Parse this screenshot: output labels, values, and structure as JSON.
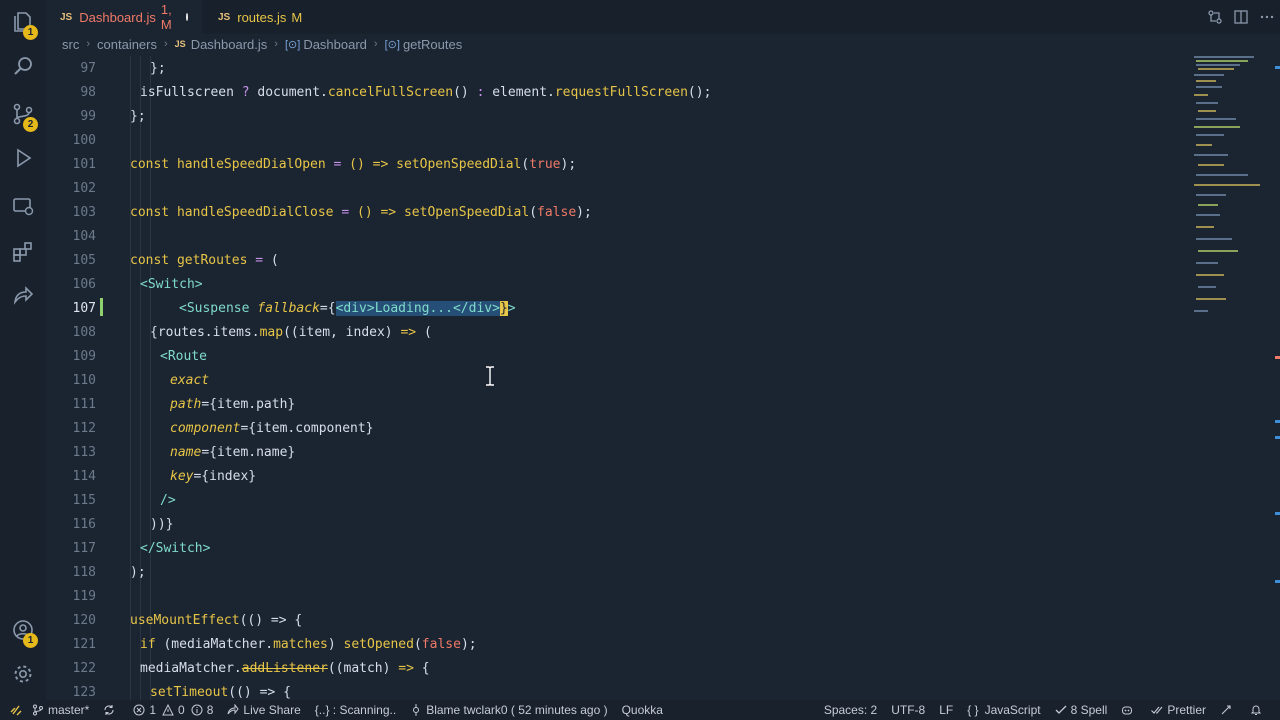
{
  "activity": {
    "explorer_badge": "1",
    "scm_badge": "2",
    "account_badge": "1"
  },
  "tabs": [
    {
      "icon": "JS",
      "name": "Dashboard.js",
      "meta": "1, M"
    },
    {
      "icon": "JS",
      "name": "routes.js",
      "meta": "M"
    }
  ],
  "breadcrumb": {
    "items": [
      "src",
      "containers",
      "Dashboard.js",
      "Dashboard",
      "getRoutes"
    ],
    "file_icon": "JS",
    "symbol_icon": "[⊙]"
  },
  "editor": {
    "line_numbers": [
      "97",
      "98",
      "99",
      "100",
      "101",
      "102",
      "103",
      "104",
      "105",
      "106",
      "107",
      "108",
      "109",
      "110",
      "111",
      "112",
      "113",
      "114",
      "115",
      "116",
      "117",
      "118",
      "119",
      "120",
      "121",
      "122",
      "123"
    ],
    "current_line": "107"
  },
  "code": {
    "l97": "};",
    "l98_a": "isFullscreen",
    "l98_b": "?",
    "l98_c": "document.",
    "l98_d": "cancelFullScreen",
    "l98_e": "()",
    "l98_f": ":",
    "l98_g": "element.",
    "l98_h": "requestFullScreen",
    "l98_i": "();",
    "l99": "};",
    "l101_a": "const",
    "l101_b": "handleSpeedDialOpen",
    "l101_c": "=",
    "l101_d": "() =>",
    "l101_e": "setOpenSpeedDial",
    "l101_f": "(",
    "l101_g": "true",
    "l101_h": ");",
    "l103_a": "const",
    "l103_b": "handleSpeedDialClose",
    "l103_c": "=",
    "l103_d": "() =>",
    "l103_e": "setOpenSpeedDial",
    "l103_f": "(",
    "l103_g": "false",
    "l103_h": ");",
    "l105_a": "const",
    "l105_b": "getRoutes",
    "l105_c": "=",
    "l105_d": "(",
    "l106": "<Switch>",
    "l107_a": "<Suspense",
    "l107_b": "fallback",
    "l107_c": "={",
    "l107_d": "<div>Loading...</div>",
    "l107_e": "}",
    "l107_f": ">",
    "l108_a": "{routes.items.",
    "l108_b": "map",
    "l108_c": "((item, index)",
    "l108_d": "=>",
    "l108_e": "(",
    "l109": "<Route",
    "l110": "exact",
    "l111_a": "path",
    "l111_b": "={item.path}",
    "l112_a": "component",
    "l112_b": "={item.component}",
    "l113_a": "name",
    "l113_b": "={item.name}",
    "l114_a": "key",
    "l114_b": "={index}",
    "l115": "/>",
    "l116": "))}",
    "l117": "</Switch>",
    "l118": ");",
    "l120_a": "useMountEffect",
    "l120_b": "(() =>",
    "l120_c": "{",
    "l121_a": "if",
    "l121_b": "(mediaMatcher.",
    "l121_c": "matches",
    "l121_d": ")",
    "l121_e": "setOpened",
    "l121_f": "(",
    "l121_g": "false",
    "l121_h": ");",
    "l122_a": "mediaMatcher.",
    "l122_b": "addListener",
    "l122_c": "((match)",
    "l122_d": "=>",
    "l122_e": "{",
    "l123_a": "setTimeout",
    "l123_b": "(() =>",
    "l123_c": "{"
  },
  "status": {
    "branch": "master*",
    "errors": "1",
    "warnings": "0",
    "info": "8",
    "live_share": "Live Share",
    "scanning": "{..} : Scanning..",
    "blame": "Blame twclark0 ( 52 minutes ago )",
    "quokka": "Quokka",
    "spaces": "Spaces: 2",
    "encoding": "UTF-8",
    "eol": "LF",
    "lang_icon": "{ }",
    "language": "JavaScript",
    "spell": "8 Spell",
    "prettier": "Prettier"
  },
  "colors": {
    "background": "#1b2431",
    "keyword": "#e7c547",
    "tag": "#7fdbca",
    "boolean": "#ef7a67",
    "selection": "#264f78",
    "badge": "#e5b91a"
  }
}
